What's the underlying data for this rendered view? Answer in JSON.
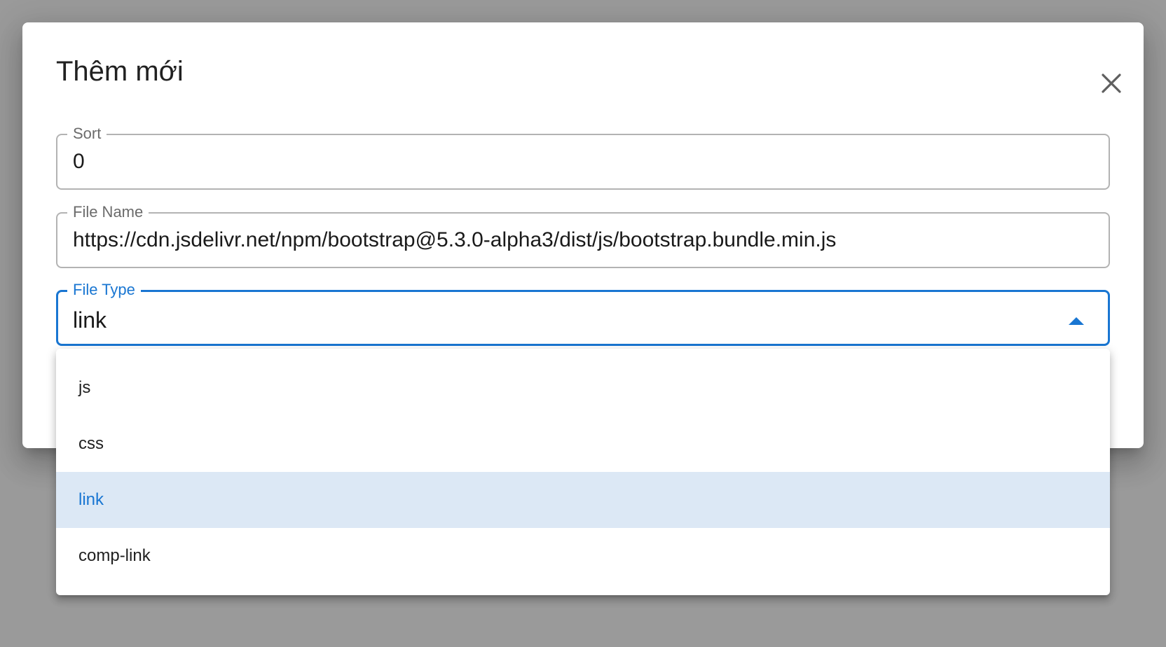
{
  "dialog": {
    "title": "Thêm mới",
    "close_icon": "close-icon"
  },
  "form": {
    "sort": {
      "label": "Sort",
      "value": "0"
    },
    "file_name": {
      "label": "File Name",
      "value": "https://cdn.jsdelivr.net/npm/bootstrap@5.3.0-alpha3/dist/js/bootstrap.bundle.min.js"
    },
    "file_type": {
      "label": "File Type",
      "value": "link",
      "dropdown_icon": "arrow-drop-up-icon"
    }
  },
  "menu": {
    "options": [
      "js",
      "css",
      "link",
      "comp-link"
    ],
    "selected": "link"
  },
  "colors": {
    "accent": "#1976d2",
    "selected_bg": "#dce8f5",
    "backdrop": "#9a9a9a"
  }
}
